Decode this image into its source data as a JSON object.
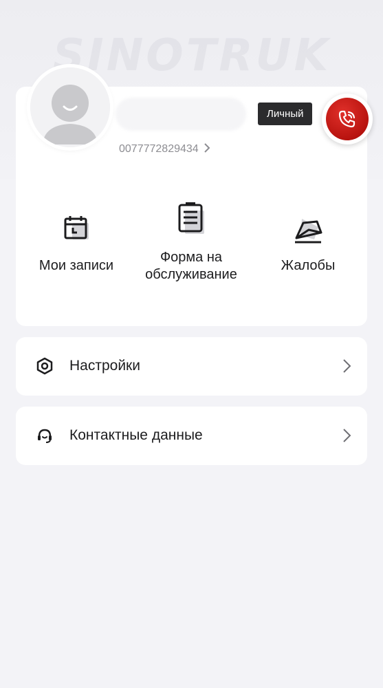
{
  "brand_watermark": "SINOTRUK",
  "profile": {
    "phone": "0077772829434",
    "badge": "Личный"
  },
  "actions": [
    {
      "label": "Мои записи",
      "icon": "calendar-icon"
    },
    {
      "label": "Форма на обслуживание",
      "icon": "form-clipboard-icon"
    },
    {
      "label": "Жалобы",
      "icon": "complaint-envelope-icon"
    }
  ],
  "menu": {
    "settings": {
      "label": "Настройки",
      "icon": "hexagon-settings-icon"
    },
    "contacts": {
      "label": "Контактные данные",
      "icon": "headset-icon"
    }
  },
  "colors": {
    "accent_red": "#c41a14",
    "card_bg": "#ffffff",
    "page_bg": "#f3f3f7"
  }
}
